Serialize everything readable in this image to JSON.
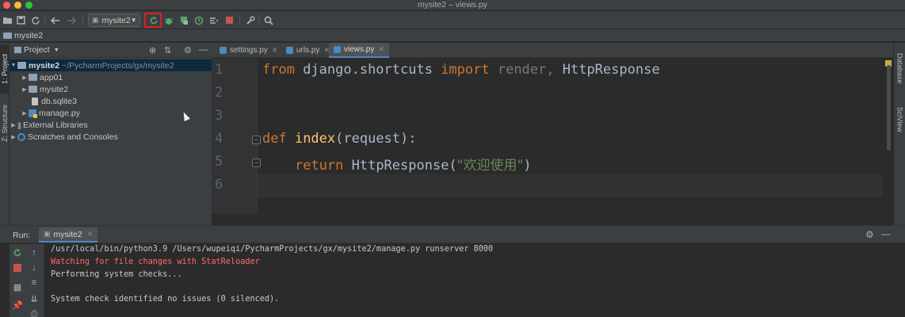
{
  "window": {
    "title": "mysite2 – views.py"
  },
  "toolbar": {
    "run_config": "mysite2",
    "icons": [
      "open-folder-icon",
      "save-icon",
      "sync-icon",
      "back-arrow-icon",
      "forward-arrow-icon",
      "rerun-icon",
      "debug-icon",
      "coverage-icon",
      "profile-icon",
      "concurrency-icon",
      "stop-icon",
      "wrench-icon",
      "search-icon"
    ]
  },
  "navbar": {
    "breadcrumb": "mysite2"
  },
  "left_stripe": {
    "project_tab": "1: Project",
    "structure_tab": "Z: Structure"
  },
  "right_stripe": {
    "database_tab": "Database",
    "sciview_tab": "SciView"
  },
  "project_panel": {
    "title": "Project",
    "tree": [
      {
        "label": "mysite2",
        "path": "~/PycharmProjects/gx/mysite2"
      },
      {
        "label": "app01"
      },
      {
        "label": "mysite2"
      },
      {
        "label": "db.sqlite3"
      },
      {
        "label": "manage.py"
      },
      {
        "label": "External Libraries"
      },
      {
        "label": "Scratches and Consoles"
      }
    ]
  },
  "editor": {
    "tabs": [
      {
        "label": "settings.py"
      },
      {
        "label": "urls.py"
      },
      {
        "label": "views.py"
      }
    ],
    "line_numbers": [
      "1",
      "2",
      "3",
      "4",
      "5",
      "6"
    ],
    "code": {
      "l1_from": "from",
      "l1_module": " django.shortcuts ",
      "l1_import": "import",
      "l1_render": " render,",
      "l1_http": " HttpResponse",
      "l4_def": "def",
      "l4_name": " index",
      "l4_args": "(request):",
      "l5_indent": "    ",
      "l5_return": "return",
      "l5_call": " HttpResponse(",
      "l5_string": "\"欢迎使用\"",
      "l5_close": ")"
    }
  },
  "run_panel": {
    "label": "Run:",
    "tab": "mysite2",
    "console": [
      "/usr/local/bin/python3.9 /Users/wupeiqi/PycharmProjects/gx/mysite2/manage.py runserver 8000",
      "Watching for file changes with StatReloader",
      "Performing system checks...",
      "",
      "System check identified no issues (0 silenced)."
    ]
  },
  "colors": {
    "background": "#2b2b2b",
    "panel": "#3c3f41",
    "keyword": "#cc7832",
    "function": "#ffc66d",
    "string": "#6a8759",
    "error_text": "#ff6b68",
    "highlight_box": "#e0201c",
    "selection": "#0d293e"
  }
}
